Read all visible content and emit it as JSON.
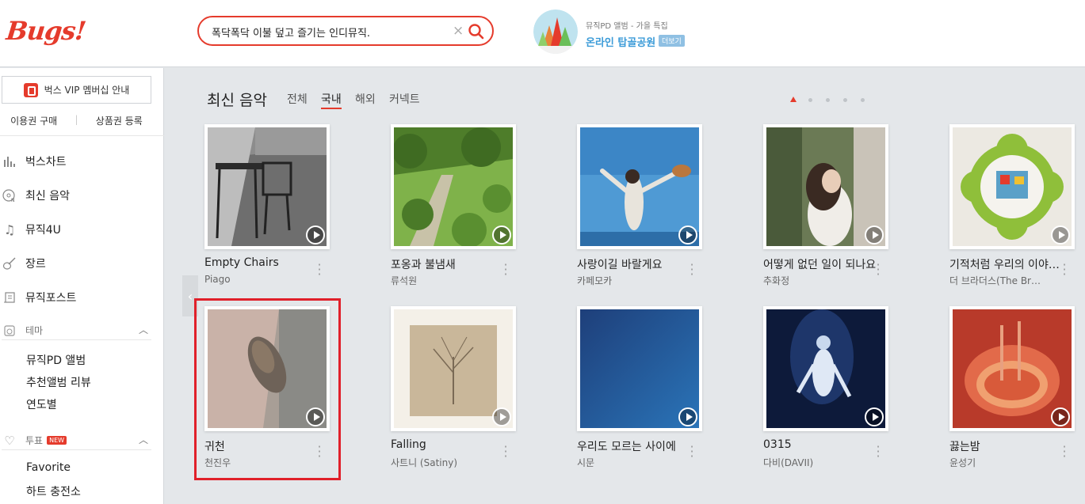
{
  "header": {
    "logo": "Bugs!",
    "search": {
      "value": "폭닥폭닥 이불 덮고 즐기는 인디뮤직.",
      "placeholder": ""
    },
    "promo": {
      "subtitle": "뮤직PD 앨범 - 가을 특집",
      "title": "온라인 탑골공원",
      "more": "더보기"
    }
  },
  "sidebar": {
    "vip_button": "벅스 VIP 멤버십 안내",
    "buy_links": [
      "이용권 구매",
      "상품권 등록"
    ],
    "nav": [
      {
        "label": "벅스차트",
        "icon": "chart-bars-icon"
      },
      {
        "label": "최신 음악",
        "icon": "new-disc-icon"
      },
      {
        "label": "뮤직4U",
        "icon": "music-note-icon"
      },
      {
        "label": "장르",
        "icon": "guitar-icon"
      },
      {
        "label": "뮤직포스트",
        "icon": "post-icon"
      }
    ],
    "theme": {
      "label": "테마",
      "items": [
        "뮤직PD 앨범",
        "추천앨범 리뷰",
        "연도별"
      ]
    },
    "vote": {
      "label": "투표",
      "badge": "NEW",
      "items": [
        "Favorite",
        "하트 충전소"
      ]
    }
  },
  "main": {
    "title": "최신 음악",
    "tabs": [
      "전체",
      "국내",
      "해외",
      "커넥트"
    ],
    "active_tab": "국내",
    "pager": {
      "total": 5,
      "current": 1
    },
    "albums": [
      {
        "title": "Empty Chairs",
        "artist": "Piago"
      },
      {
        "title": "포옹과 불냄새",
        "artist": "류석원"
      },
      {
        "title": "사랑이길 바랄게요",
        "artist": "카페모카"
      },
      {
        "title": "어떻게 없던 일이 되나요",
        "artist": "추화정"
      },
      {
        "title": "기적처럼 우리의 이야…",
        "artist": "더 브라더스(The Br…"
      },
      {
        "title": "귀천",
        "artist": "천진우"
      },
      {
        "title": "Falling",
        "artist": "사트니 (Satiny)"
      },
      {
        "title": "우리도 모르는 사이에",
        "artist": "시문"
      },
      {
        "title": "0315",
        "artist": "다비(DAVII)"
      },
      {
        "title": "끓는밤",
        "artist": "윤성기"
      }
    ]
  },
  "colors": {
    "accent": "#e53b2c",
    "link": "#3b9bd8",
    "background": "#e4e7ea"
  }
}
